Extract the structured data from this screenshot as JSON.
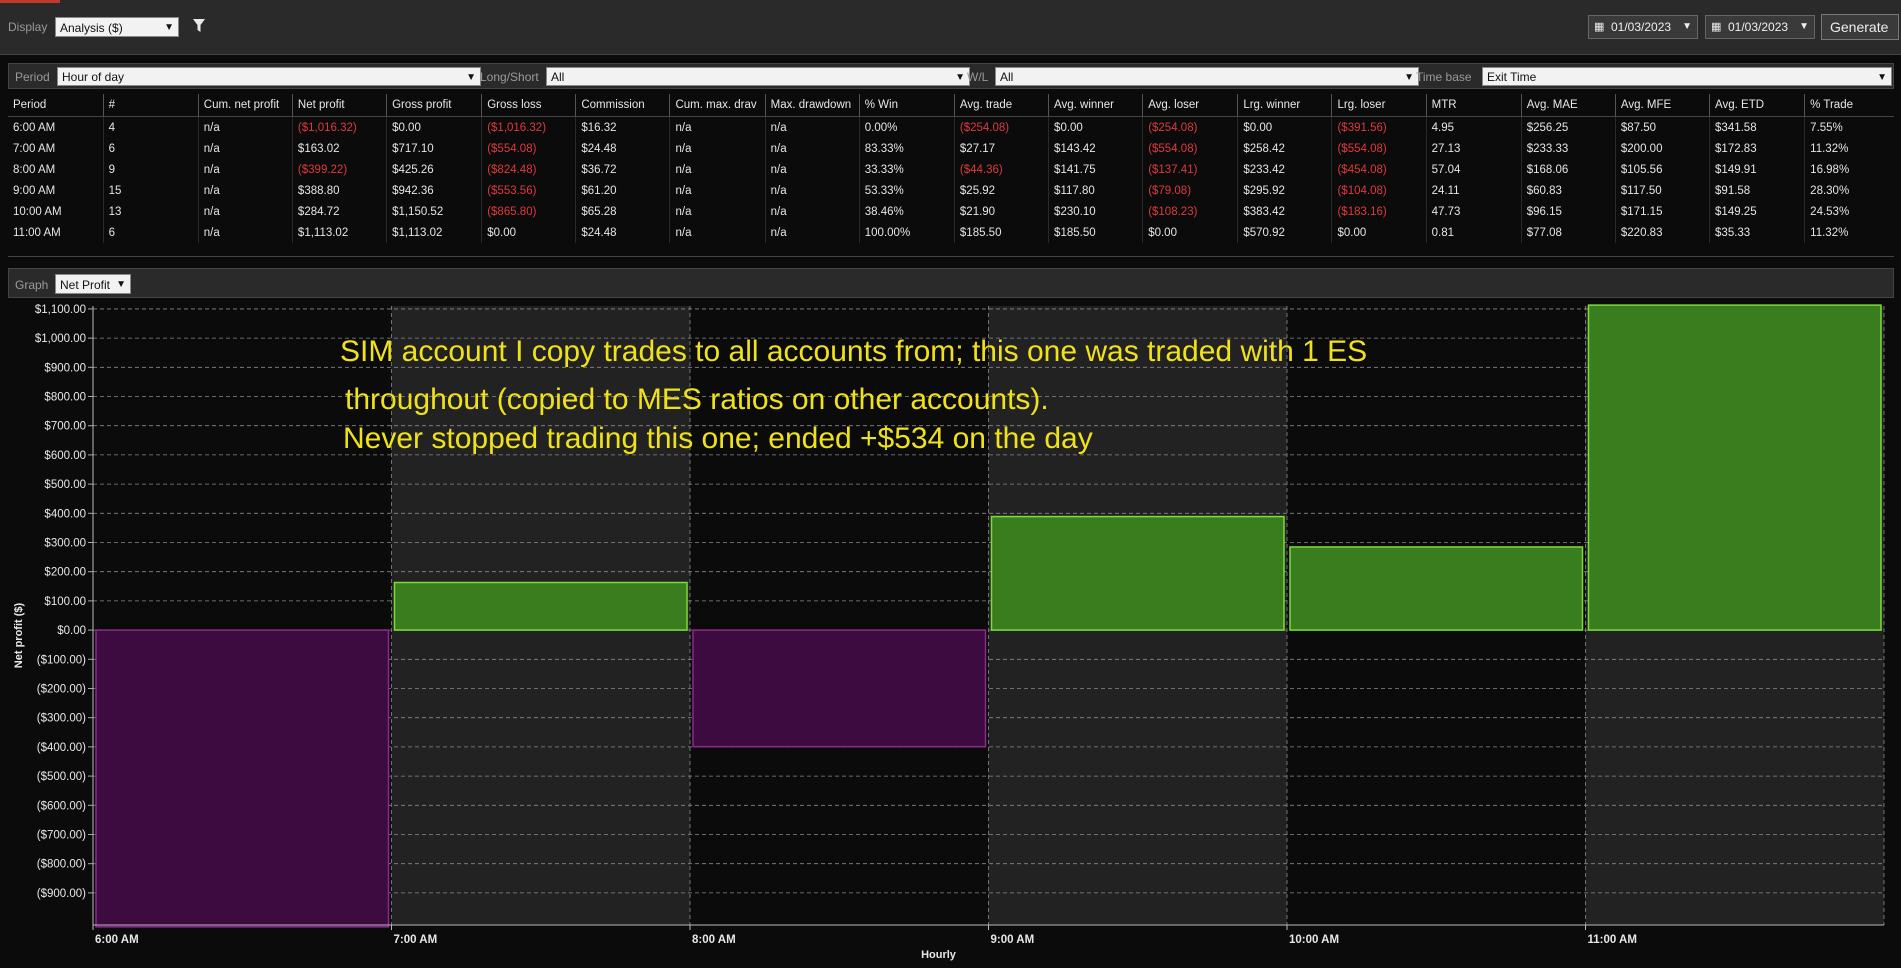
{
  "toolbar": {
    "display_label": "Display",
    "display_value": "Analysis ($)",
    "filter_icon": "filter-icon",
    "date_from": "01/03/2023",
    "date_to": "01/03/2023",
    "generate_label": "Generate"
  },
  "filters": {
    "period_label": "Period",
    "period_value": "Hour of day",
    "longshort_label": "Long/Short",
    "longshort_value": "All",
    "wl_label": "W/L",
    "wl_value": "All",
    "timebase_label": "Time base",
    "timebase_value": "Exit Time"
  },
  "table": {
    "columns": [
      "Period",
      "#",
      "Cum. net profit",
      "Net profit",
      "Gross profit",
      "Gross loss",
      "Commission",
      "Cum. max. drav",
      "Max. drawdown",
      "% Win",
      "Avg. trade",
      "Avg. winner",
      "Avg. loser",
      "Lrg. winner",
      "Lrg. loser",
      "MTR",
      "Avg. MAE",
      "Avg. MFE",
      "Avg. ETD",
      "% Trade"
    ],
    "rows": [
      [
        "6:00 AM",
        "4",
        "n/a",
        "($1,016.32)",
        "$0.00",
        "($1,016.32)",
        "$16.32",
        "n/a",
        "n/a",
        "0.00%",
        "($254.08)",
        "$0.00",
        "($254.08)",
        "$0.00",
        "($391.56)",
        "4.95",
        "$256.25",
        "$87.50",
        "$341.58",
        "7.55%"
      ],
      [
        "7:00 AM",
        "6",
        "n/a",
        "$163.02",
        "$717.10",
        "($554.08)",
        "$24.48",
        "n/a",
        "n/a",
        "83.33%",
        "$27.17",
        "$143.42",
        "($554.08)",
        "$258.42",
        "($554.08)",
        "27.13",
        "$233.33",
        "$200.00",
        "$172.83",
        "11.32%"
      ],
      [
        "8:00 AM",
        "9",
        "n/a",
        "($399.22)",
        "$425.26",
        "($824.48)",
        "$36.72",
        "n/a",
        "n/a",
        "33.33%",
        "($44.36)",
        "$141.75",
        "($137.41)",
        "$233.42",
        "($454.08)",
        "57.04",
        "$168.06",
        "$105.56",
        "$149.91",
        "16.98%"
      ],
      [
        "9:00 AM",
        "15",
        "n/a",
        "$388.80",
        "$942.36",
        "($553.56)",
        "$61.20",
        "n/a",
        "n/a",
        "53.33%",
        "$25.92",
        "$117.80",
        "($79.08)",
        "$295.92",
        "($104.08)",
        "24.11",
        "$60.83",
        "$117.50",
        "$91.58",
        "28.30%"
      ],
      [
        "10:00 AM",
        "13",
        "n/a",
        "$284.72",
        "$1,150.52",
        "($865.80)",
        "$65.28",
        "n/a",
        "n/a",
        "38.46%",
        "$21.90",
        "$230.10",
        "($108.23)",
        "$383.42",
        "($183.16)",
        "47.73",
        "$96.15",
        "$171.15",
        "$149.25",
        "24.53%"
      ],
      [
        "11:00 AM",
        "6",
        "n/a",
        "$1,113.02",
        "$1,113.02",
        "$0.00",
        "$24.48",
        "n/a",
        "n/a",
        "100.00%",
        "$185.50",
        "$185.50",
        "$0.00",
        "$570.92",
        "$0.00",
        "0.81",
        "$77.08",
        "$220.83",
        "$35.33",
        "11.32%"
      ]
    ]
  },
  "graph": {
    "label": "Graph",
    "select_value": "Net Profit"
  },
  "chart_data": {
    "type": "bar",
    "categories": [
      "6:00 AM",
      "7:00 AM",
      "8:00 AM",
      "9:00 AM",
      "10:00 AM",
      "11:00 AM"
    ],
    "values": [
      -1016.32,
      163.02,
      -399.22,
      388.8,
      284.72,
      1113.02
    ],
    "ylabel": "Net profit ($)",
    "xlabel": "Hourly",
    "ylim": [
      -1000,
      1100
    ],
    "yticks": [
      "$1,100.00",
      "$1,000.00",
      "$900.00",
      "$800.00",
      "$700.00",
      "$600.00",
      "$500.00",
      "$400.00",
      "$300.00",
      "$200.00",
      "$100.00",
      "$0.00",
      "($100.00)",
      "($200.00)",
      "($300.00)",
      "($400.00)",
      "($500.00)",
      "($600.00)",
      "($700.00)",
      "($800.00)",
      "($900.00)"
    ],
    "ytick_values": [
      1100,
      1000,
      900,
      800,
      700,
      600,
      500,
      400,
      300,
      200,
      100,
      0,
      -100,
      -200,
      -300,
      -400,
      -500,
      -600,
      -700,
      -800,
      -900
    ],
    "grid": true,
    "positive_color": "#3a7d1e",
    "positive_edge": "#7ddc3a",
    "negative_color": "#3d0b40",
    "negative_edge": "#8a2b8f"
  },
  "annotation": {
    "line1": "SIM account I copy trades to all accounts from; this  one was traded with 1 ES",
    "line2": "throughout (copied to MES ratios on other accounts).",
    "line3": "Never stopped trading this one; ended +$534 on the  day",
    "color": "#f0e21a"
  }
}
